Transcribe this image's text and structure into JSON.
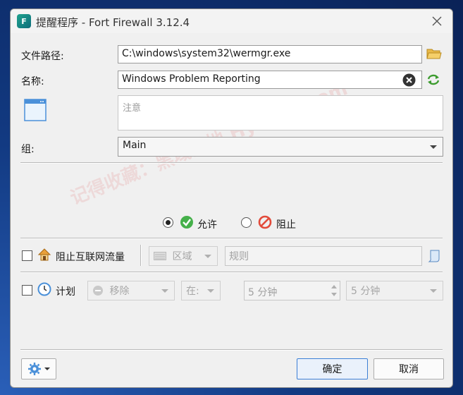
{
  "window": {
    "title": "提醒程序 - Fort Firewall 3.12.4",
    "app_icon_text": "F"
  },
  "form": {
    "path_label": "文件路径:",
    "path_value": "C:\\windows\\system32\\wermgr.exe",
    "name_label": "名称:",
    "name_value": "Windows Problem Reporting",
    "notes_placeholder": "注意",
    "group_label": "组:",
    "group_value": "Main"
  },
  "action": {
    "allow_label": "允许",
    "block_label": "阻止",
    "selected": "allow"
  },
  "block_internet": {
    "label": "阻止互联网流量",
    "zones_label": "区域",
    "rules_placeholder": "规则"
  },
  "schedule": {
    "label": "计划",
    "action_value": "移除",
    "in_value": "在:",
    "time_spin_value": "5 分钟",
    "time_combo_value": "5 分钟"
  },
  "footer": {
    "ok_label": "确定",
    "cancel_label": "取消"
  },
  "watermark": {
    "text": "记得收藏：黑域基地 Hybase.com"
  },
  "colors": {
    "allow_green": "#45b04a",
    "block_red": "#e24a3a",
    "accent_blue": "#3c7fd6"
  }
}
